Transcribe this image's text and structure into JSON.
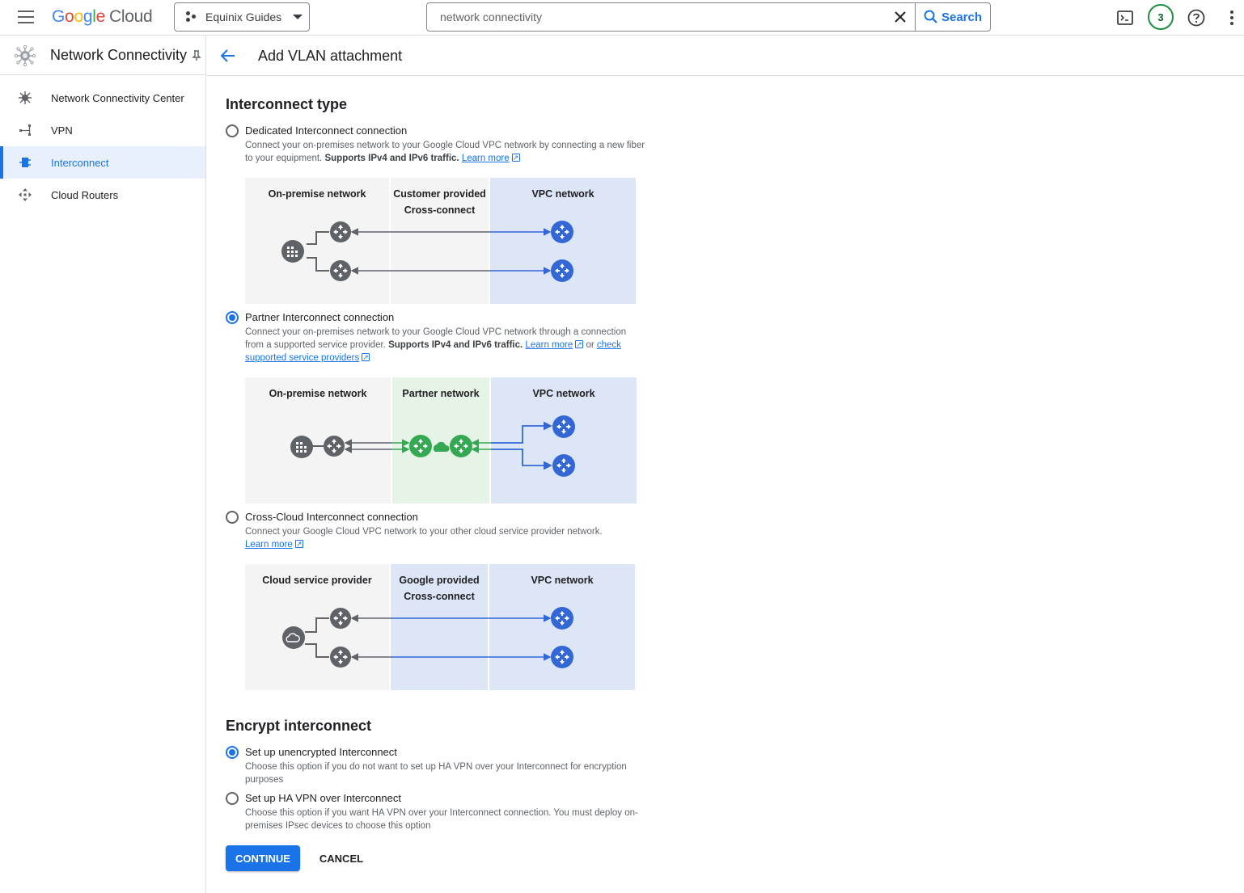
{
  "topbar": {
    "logo": {
      "google": "Google",
      "cloud": "Cloud"
    },
    "project_name": "Equinix Guides",
    "search": {
      "value": "network connectivity",
      "button_label": "Search"
    },
    "notifications_count": "3"
  },
  "sidebar": {
    "title": "Network Connectivity",
    "items": [
      {
        "label": "Network Connectivity Center",
        "icon": "hub-icon",
        "active": false
      },
      {
        "label": "VPN",
        "icon": "vpn-icon",
        "active": false
      },
      {
        "label": "Interconnect",
        "icon": "interconnect-icon",
        "active": true
      },
      {
        "label": "Cloud Routers",
        "icon": "router-icon",
        "active": false
      }
    ]
  },
  "header": {
    "title": "Add VLAN attachment"
  },
  "interconnect_type": {
    "heading": "Interconnect type",
    "options": [
      {
        "label": "Dedicated Interconnect connection",
        "checked": false,
        "desc": "Connect your on-premises network to your Google Cloud VPC network by connecting a new fiber to your equipment.",
        "desc_bold": "Supports IPv4 and IPv6 traffic.",
        "link1": "Learn more",
        "diagram": {
          "col1": "On-premise network",
          "col2_line1": "Customer provided",
          "col2_line2": "Cross-connect",
          "col3": "VPC network"
        }
      },
      {
        "label": "Partner Interconnect connection",
        "checked": true,
        "desc": "Connect your on-premises network to your Google Cloud VPC network through a connection from a supported service provider.",
        "desc_bold": "Supports IPv4 and IPv6 traffic.",
        "link1": "Learn more",
        "or": "or",
        "link2": "check supported service providers",
        "diagram": {
          "col1": "On-premise network",
          "col2_line1": "Partner network",
          "col3": "VPC network"
        }
      },
      {
        "label": "Cross-Cloud Interconnect connection",
        "checked": false,
        "desc": "Connect your Google Cloud VPC network to your other cloud service provider network.",
        "link1": "Learn more",
        "diagram": {
          "col1": "Cloud service provider",
          "col2_line1": "Google provided",
          "col2_line2": "Cross-connect",
          "col3": "VPC network"
        }
      }
    ]
  },
  "encrypt": {
    "heading": "Encrypt interconnect",
    "options": [
      {
        "label": "Set up unencrypted Interconnect",
        "checked": true,
        "desc": "Choose this option if you do not want to set up HA VPN over your Interconnect for encryption purposes"
      },
      {
        "label": "Set up HA VPN over Interconnect",
        "checked": false,
        "desc": "Choose this option if you want HA VPN over your Interconnect connection. You must deploy on-premises IPsec devices to choose this option"
      }
    ]
  },
  "actions": {
    "continue": "CONTINUE",
    "cancel": "CANCEL"
  },
  "colors": {
    "accent": "#1a73e8",
    "router_grey": "#5f6368",
    "router_green": "#34a853",
    "line_blue": "#3367d6"
  }
}
